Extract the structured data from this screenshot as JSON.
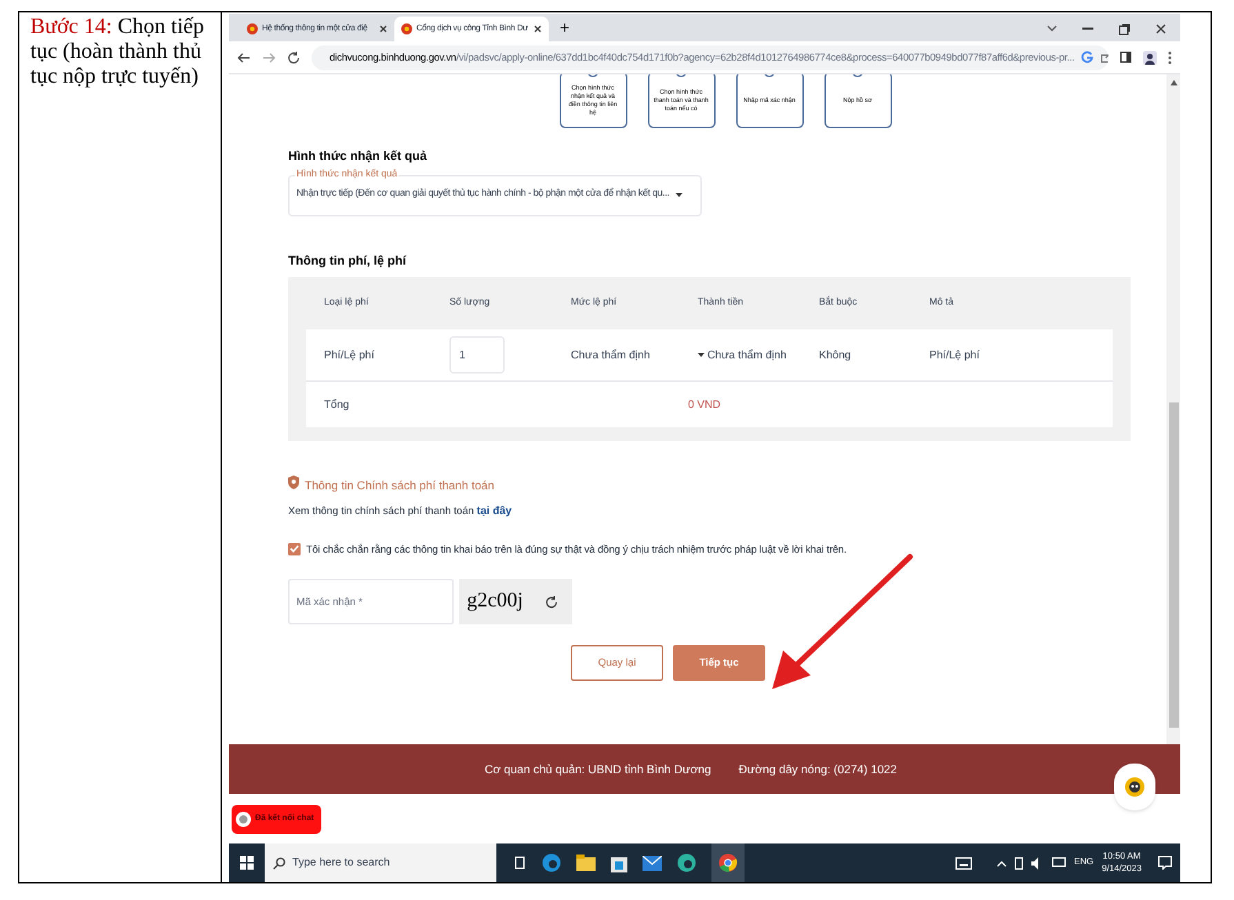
{
  "instruction": {
    "step_label": "Bước 14:",
    "text": "Chọn tiếp tục (hoàn thành thủ tục nộp trực tuyến)"
  },
  "browser": {
    "tabs": [
      {
        "title": "Hệ thống thông tin một cửa điệ",
        "selected": false
      },
      {
        "title": "Cổng dịch vụ công Tỉnh Bình Dư",
        "selected": true
      }
    ],
    "new_tab": "+",
    "url_host": "dichvucong.binhduong.gov.vn",
    "url_path": "/vi/padsvc/apply-online/637dd1bc4f40dc754d171f0b?agency=62b28f4d1012764986774ce8&process=640077b0949bd077f87aff6d&previous-pr..."
  },
  "steps": [
    "Chọn hình thức nhận kết quả và điền thông tin liên hệ",
    "Chọn hình thức thanh toán và thanh toán nếu có",
    "Nhập mã xác nhận",
    "Nộp hồ sơ"
  ],
  "result_section": {
    "heading": "Hình thức nhận kết quả",
    "field_label": "Hình thức nhận kết quả",
    "field_value": "Nhận trực tiếp (Đến cơ quan giải quyết thủ tục hành chính - bộ phận một cửa để nhận kết qu..."
  },
  "fee_section": {
    "heading": "Thông tin phí, lệ phí",
    "columns": [
      "Loại lệ phí",
      "Số lượng",
      "Mức lệ phí",
      "Thành tiền",
      "Bắt buộc",
      "Mô tả"
    ],
    "rows": [
      {
        "type": "Phí/Lệ phí",
        "quantity": "1",
        "rate": "Chưa thẩm định",
        "amount": "Chưa thẩm định",
        "required": "Không",
        "description": "Phí/Lệ phí"
      }
    ],
    "total_label": "Tổng",
    "total_value": "0 VND"
  },
  "policy": {
    "heading": "Thông tin Chính sách phí thanh toán",
    "text": "Xem thông tin chính sách phí thanh toán",
    "link": "tại đây"
  },
  "agreement": {
    "checked": true,
    "text": "Tôi chắc chắn rằng các thông tin khai báo trên là đúng sự thật và đồng ý chịu trách nhiệm trước pháp luật về lời khai trên."
  },
  "captcha": {
    "placeholder": "Mã xác nhận *",
    "code": "g2c00j"
  },
  "buttons": {
    "back": "Quay lại",
    "continue": "Tiếp tục"
  },
  "footer": {
    "agency": "Cơ quan chủ quản: UBND tỉnh Bình Dương",
    "hotline": "Đường dây nóng: (0274) 1022"
  },
  "chat_pill": "Đã kết nối chat",
  "taskbar": {
    "search_placeholder": "Type here to search",
    "language": "ENG",
    "time": "10:50 AM",
    "date": "9/14/2023"
  }
}
